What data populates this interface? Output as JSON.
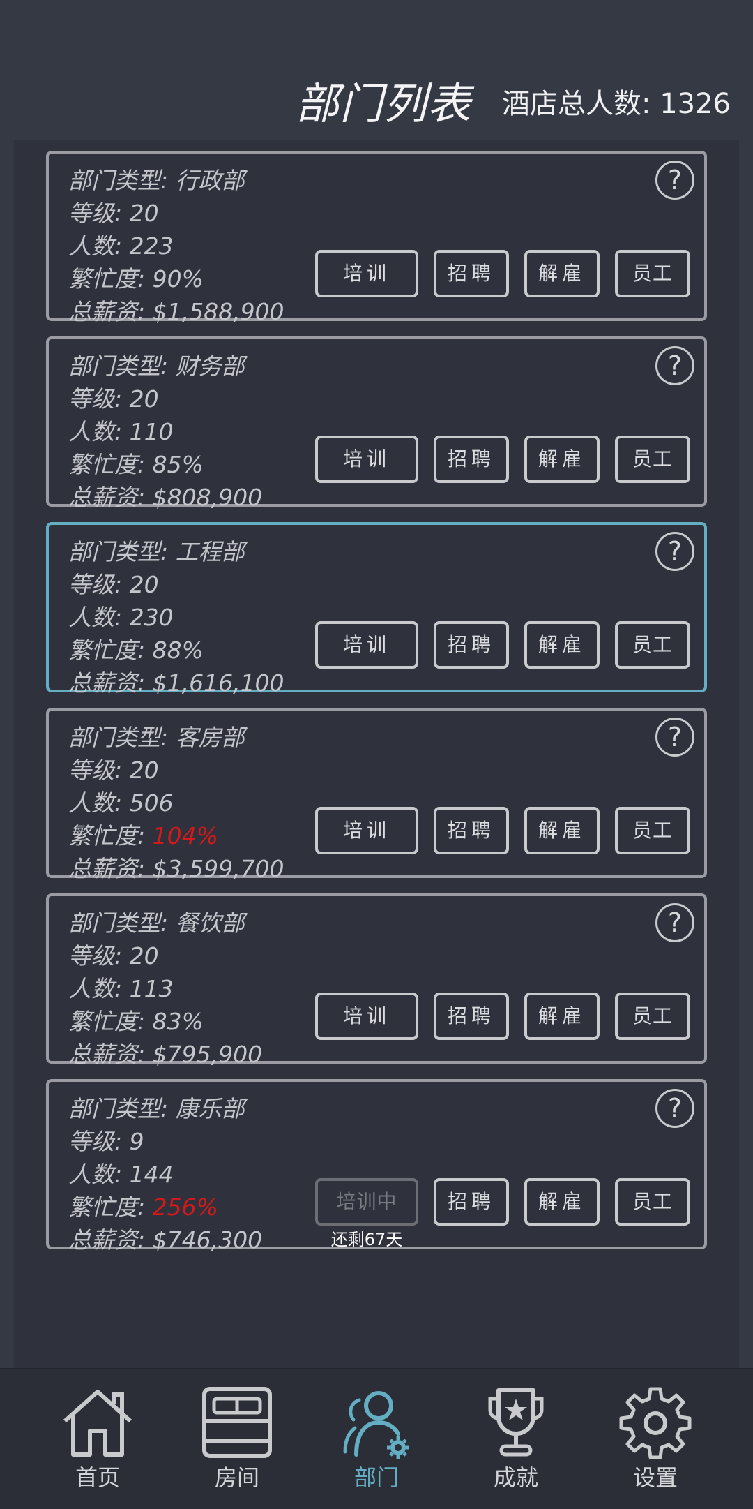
{
  "header": {
    "title": "部门列表",
    "total_staff": "酒店总人数: 1326"
  },
  "departments": [
    {
      "type": "部门类型: 行政部",
      "level": "等级: 20",
      "staff": "人数: 223",
      "busy_label": "繁忙度: ",
      "busy_value": "90%",
      "busy_warn": false,
      "salary": "总薪资: $1,588,900",
      "train_label": "培训",
      "selected": false
    },
    {
      "type": "部门类型: 财务部",
      "level": "等级: 20",
      "staff": "人数: 110",
      "busy_label": "繁忙度: ",
      "busy_value": "85%",
      "busy_warn": false,
      "salary": "总薪资: $808,900",
      "train_label": "培训",
      "selected": false
    },
    {
      "type": "部门类型: 工程部",
      "level": "等级: 20",
      "staff": "人数: 230",
      "busy_label": "繁忙度: ",
      "busy_value": "88%",
      "busy_warn": false,
      "salary": "总薪资: $1,616,100",
      "train_label": "培训",
      "selected": true
    },
    {
      "type": "部门类型: 客房部",
      "level": "等级: 20",
      "staff": "人数: 506",
      "busy_label": "繁忙度: ",
      "busy_value": "104%",
      "busy_warn": true,
      "salary": "总薪资: $3,599,700",
      "train_label": "培训",
      "selected": false
    },
    {
      "type": "部门类型: 餐饮部",
      "level": "等级: 20",
      "staff": "人数: 113",
      "busy_label": "繁忙度: ",
      "busy_value": "83%",
      "busy_warn": false,
      "salary": "总薪资: $795,900",
      "train_label": "培训",
      "selected": false
    },
    {
      "type": "部门类型: 康乐部",
      "level": "等级: 9",
      "staff": "人数: 144",
      "busy_label": "繁忙度: ",
      "busy_value": "256%",
      "busy_warn": true,
      "salary": "总薪资: $746,300",
      "train_label": "培训中",
      "training": true,
      "train_remaining": "还剩67天",
      "selected": false
    }
  ],
  "buttons": {
    "hire": "招聘",
    "fire": "解雇",
    "staff": "员工",
    "help": "?"
  },
  "nav": [
    {
      "label": "首页",
      "icon": "home-icon",
      "active": false
    },
    {
      "label": "房间",
      "icon": "bed-icon",
      "active": false
    },
    {
      "label": "部门",
      "icon": "staff-gear-icon",
      "active": true
    },
    {
      "label": "成就",
      "icon": "trophy-icon",
      "active": false
    },
    {
      "label": "设置",
      "icon": "gear-icon",
      "active": false
    }
  ],
  "colors": {
    "background": "#353944",
    "panel": "#2f313c",
    "accent": "#63aec3",
    "warning": "#d11a1a",
    "border": "#9b9ca3"
  }
}
